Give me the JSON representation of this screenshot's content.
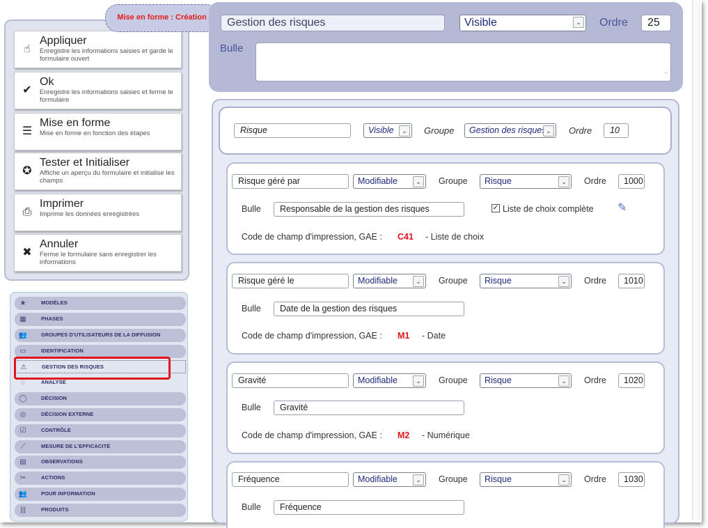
{
  "mode_tag": "Mise en forme : Création",
  "actions": [
    {
      "title": "Appliquer",
      "desc": "Enregistre les informations saisies et garde le formulaire ouvert",
      "icon": "apply-icon"
    },
    {
      "title": "Ok",
      "desc": "Enregistre les informations saisies et ferme le formulaire",
      "icon": "check-icon"
    },
    {
      "title": "Mise en forme",
      "desc": "Mise en forme en fonction des étapes",
      "icon": "list-icon"
    },
    {
      "title": "Tester et Initialiser",
      "desc": "Affiche un aperçu du formulaire et initialise les champs",
      "icon": "check-circle-icon"
    },
    {
      "title": "Imprimer",
      "desc": "Imprime les données enregistrées",
      "icon": "print-icon"
    },
    {
      "title": "Annuler",
      "desc": "Ferme le formulaire sans enregistrer les informations",
      "icon": "close-icon"
    }
  ],
  "nav": [
    {
      "label": "Modèles",
      "icon": "star-icon"
    },
    {
      "label": "Phases",
      "icon": "grid-icon"
    },
    {
      "label": "Groupes d'utilisateurs de la diffusion",
      "icon": "users-icon"
    },
    {
      "label": "Identification",
      "icon": "id-card-icon"
    },
    {
      "label": "Gestion des risques",
      "icon": "warning-icon"
    },
    {
      "label": "Analyse",
      "icon": "spinner-icon"
    },
    {
      "label": "Décision",
      "icon": "comment-icon"
    },
    {
      "label": "Décision externe",
      "icon": "comments-icon"
    },
    {
      "label": "Contrôle",
      "icon": "checkbox-icon"
    },
    {
      "label": "Mesure de l'efficacité",
      "icon": "chart-icon"
    },
    {
      "label": "Observations",
      "icon": "document-icon"
    },
    {
      "label": "Actions",
      "icon": "scissors-icon"
    },
    {
      "label": "Pour information",
      "icon": "group-icon"
    },
    {
      "label": "Produits",
      "icon": "barcode-icon"
    }
  ],
  "section": {
    "title": "Gestion des risques",
    "visibility": "Visible",
    "order_label": "Ordre",
    "order": "25",
    "bubble_label": "Bulle",
    "bubble": ""
  },
  "group": {
    "name": "Risque",
    "visibility": "Visible",
    "group_label": "Groupe",
    "group": "Gestion des risques",
    "order_label": "Ordre",
    "order": "10"
  },
  "fields": [
    {
      "name": "Risque géré par",
      "mode": "Modifiable",
      "group_label": "Groupe",
      "group": "Risque",
      "order_label": "Ordre",
      "order": "1000",
      "bubble_label": "Bulle",
      "bubble": "Responsable de la gestion des risques",
      "checkbox_label": "Liste de choix complète",
      "checkbox_checked": true,
      "code_label": "Code de champ d'impression, GAE :",
      "code": "C41",
      "type": "- Liste de choix"
    },
    {
      "name": "Risque géré le",
      "mode": "Modifiable",
      "group_label": "Groupe",
      "group": "Risque",
      "order_label": "Ordre",
      "order": "1010",
      "bubble_label": "Bulle",
      "bubble": "Date de la gestion des risques",
      "code_label": "Code de champ d'impression, GAE :",
      "code": "M1",
      "type": "- Date"
    },
    {
      "name": "Gravité",
      "mode": "Modifiable",
      "group_label": "Groupe",
      "group": "Risque",
      "order_label": "Ordre",
      "order": "1020",
      "bubble_label": "Bulle",
      "bubble": "Gravité",
      "code_label": "Code de champ d'impression, GAE :",
      "code": "M2",
      "type": "- Numérique"
    },
    {
      "name": "Fréquence",
      "mode": "Modifiable",
      "group_label": "Groupe",
      "group": "Risque",
      "order_label": "Ordre",
      "order": "1030",
      "bubble_label": "Bulle",
      "bubble": "Fréquence"
    }
  ]
}
